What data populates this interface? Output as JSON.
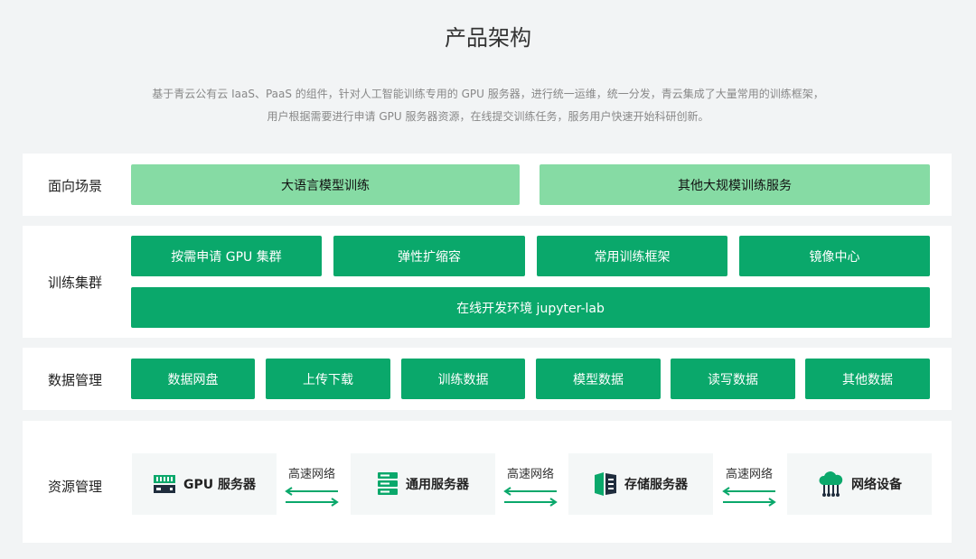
{
  "title": "产品架构",
  "description": [
    "基于青云公有云 IaaS、PaaS 的组件，针对人工智能训练专用的 GPU 服务器，进行统一运维，统一分发，青云集成了大量常用的训练框架，",
    "用户根据需要进行申请 GPU 服务器资源，在线提交训练任务，服务用户快速开始科研创新。"
  ],
  "rows": {
    "scenario": {
      "label": "面向场景",
      "items": [
        "大语言模型训练",
        "其他大规模训练服务"
      ]
    },
    "cluster": {
      "label": "训练集群",
      "items": [
        "按需申请 GPU 集群",
        "弹性扩缩容",
        "常用训练框架",
        "镜像中心"
      ],
      "wide": "在线开发环境 jupyter-lab"
    },
    "data": {
      "label": "数据管理",
      "items": [
        "数据网盘",
        "上传下载",
        "训练数据",
        "模型数据",
        "读写数据",
        "其他数据"
      ]
    },
    "resource": {
      "label": "资源管理",
      "items": [
        {
          "label": "GPU 服务器",
          "icon": "gpu-server-icon"
        },
        {
          "label": "通用服务器",
          "icon": "server-stack-icon"
        },
        {
          "label": "存储服务器",
          "icon": "storage-icon"
        },
        {
          "label": "网络设备",
          "icon": "cloud-network-icon"
        }
      ],
      "link_label": "高速网络"
    }
  },
  "colors": {
    "primary": "#0aa86b",
    "light": "#86dba4",
    "arrow": "#0aa86b",
    "icon_dark": "#1f2d3d"
  }
}
